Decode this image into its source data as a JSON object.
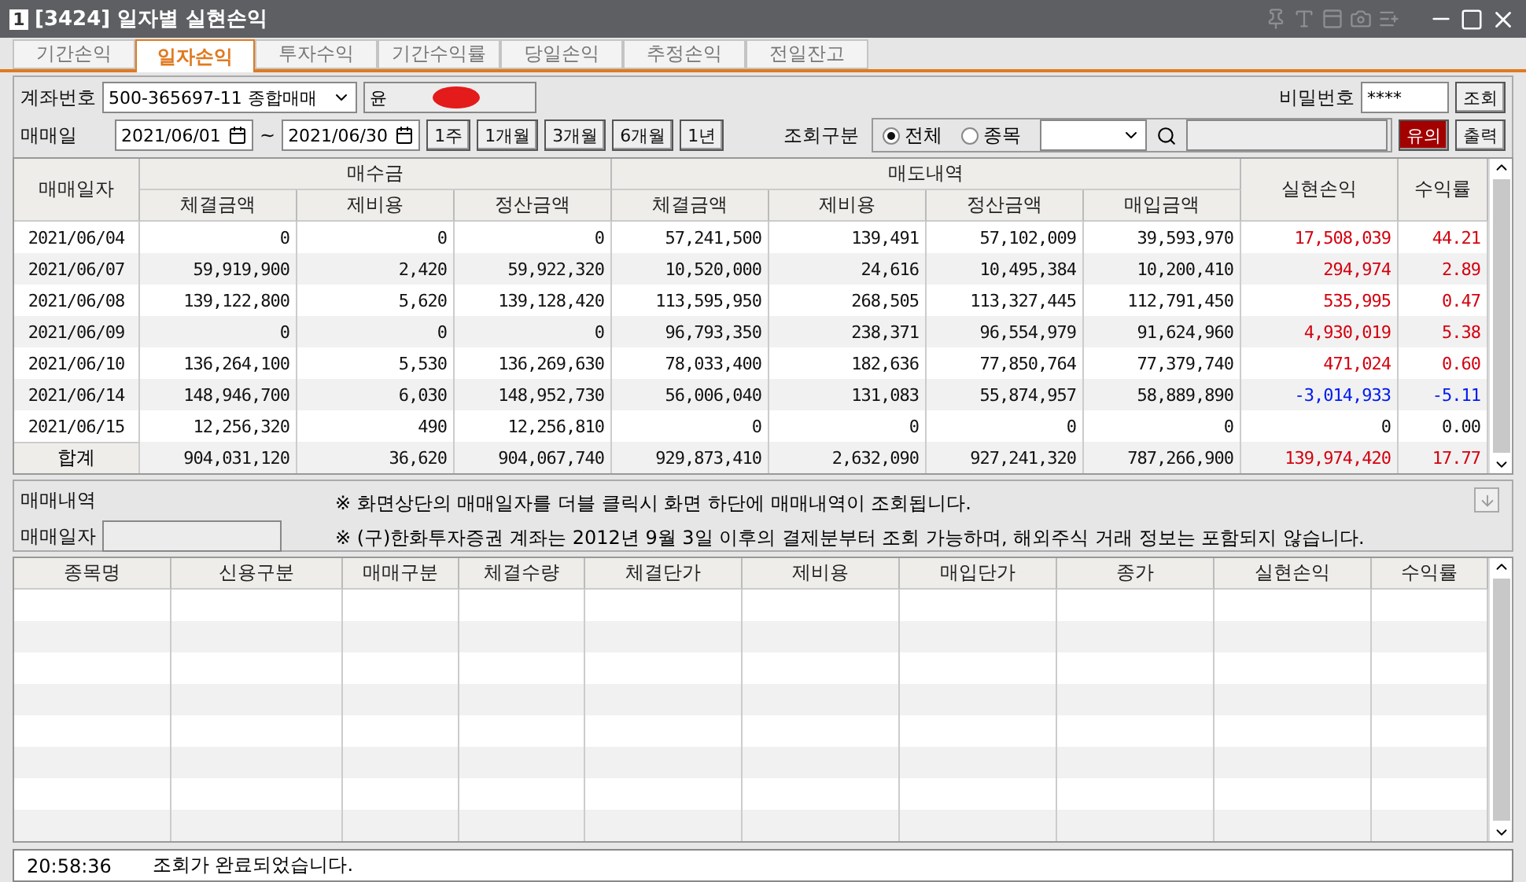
{
  "window": {
    "badge": "1",
    "title": "[3424] 일자별 실현손익"
  },
  "tabs": [
    {
      "label": "기간손익",
      "selected": false
    },
    {
      "label": "일자손익",
      "selected": true
    },
    {
      "label": "투자수익",
      "selected": false
    },
    {
      "label": "기간수익률",
      "selected": false
    },
    {
      "label": "당일손익",
      "selected": false
    },
    {
      "label": "추정손익",
      "selected": false
    },
    {
      "label": "전일잔고",
      "selected": false
    }
  ],
  "form": {
    "account_label": "계좌번호",
    "account_value": "500-365697-11 종합매매",
    "account_name": "윤",
    "password_label": "비밀번호",
    "password_value": "****",
    "query_button": "조회",
    "date_label": "매매일",
    "date_from": "2021/06/01",
    "date_sep": "~",
    "date_to": "2021/06/30",
    "periods": [
      "1주",
      "1개월",
      "3개월",
      "6개월",
      "1년"
    ],
    "scope_label": "조회구분",
    "scope_options": [
      {
        "label": "전체",
        "selected": true
      },
      {
        "label": "종목",
        "selected": false
      }
    ],
    "notice_button": "유의",
    "print_button": "출력"
  },
  "summary_table": {
    "group_headers": [
      "매수금",
      "매도내역"
    ],
    "date_header": "매매일자",
    "columns": [
      "체결금액",
      "제비용",
      "정산금액",
      "체결금액",
      "제비용",
      "정산금액",
      "매입금액"
    ],
    "pnl_header": "실현손익",
    "rate_header": "수익률",
    "rows": [
      {
        "date": "2021/06/04",
        "cells": [
          "0",
          "0",
          "0",
          "57,241,500",
          "139,491",
          "57,102,009",
          "39,593,970"
        ],
        "pnl": "17,508,039",
        "rate": "44.21",
        "color": "#d4000f"
      },
      {
        "date": "2021/06/07",
        "cells": [
          "59,919,900",
          "2,420",
          "59,922,320",
          "10,520,000",
          "24,616",
          "10,495,384",
          "10,200,410"
        ],
        "pnl": "294,974",
        "rate": "2.89",
        "color": "#d4000f"
      },
      {
        "date": "2021/06/08",
        "cells": [
          "139,122,800",
          "5,620",
          "139,128,420",
          "113,595,950",
          "268,505",
          "113,327,445",
          "112,791,450"
        ],
        "pnl": "535,995",
        "rate": "0.47",
        "color": "#d4000f"
      },
      {
        "date": "2021/06/09",
        "cells": [
          "0",
          "0",
          "0",
          "96,793,350",
          "238,371",
          "96,554,979",
          "91,624,960"
        ],
        "pnl": "4,930,019",
        "rate": "5.38",
        "color": "#d4000f"
      },
      {
        "date": "2021/06/10",
        "cells": [
          "136,264,100",
          "5,530",
          "136,269,630",
          "78,033,400",
          "182,636",
          "77,850,764",
          "77,379,740"
        ],
        "pnl": "471,024",
        "rate": "0.60",
        "color": "#d4000f"
      },
      {
        "date": "2021/06/14",
        "cells": [
          "148,946,700",
          "6,030",
          "148,952,730",
          "56,006,040",
          "131,083",
          "55,874,957",
          "58,889,890"
        ],
        "pnl": "-3,014,933",
        "rate": "-5.11",
        "color": "#0018f0"
      },
      {
        "date": "2021/06/15",
        "cells": [
          "12,256,320",
          "490",
          "12,256,810",
          "0",
          "0",
          "0",
          "0"
        ],
        "pnl": "0",
        "rate": "0.00",
        "color": "#111111"
      }
    ],
    "total": {
      "label": "합계",
      "cells": [
        "904,031,120",
        "36,620",
        "904,067,740",
        "929,873,410",
        "2,632,090",
        "927,241,320",
        "787,266,900"
      ],
      "pnl": "139,974,420",
      "rate": "17.77",
      "color": "#d4000f"
    }
  },
  "detail_info": {
    "title": "매매내역",
    "date_label": "매매일자",
    "notes": [
      "※ 화면상단의 매매일자를 더블 클릭시 화면 하단에 매매내역이 조회됩니다.",
      "※ (구)한화투자증권 계좌는 2012년 9월 3일 이후의 결제분부터 조회 가능하며, 해외주식 거래 정보는 포함되지 않습니다."
    ]
  },
  "detail_table": {
    "columns": [
      "종목명",
      "신용구분",
      "매매구분",
      "체결수량",
      "체결단가",
      "제비용",
      "매입단가",
      "종가",
      "실현손익",
      "수익률"
    ]
  },
  "status_bar": {
    "time": "20:58:36",
    "message": "조회가 완료되었습니다."
  }
}
